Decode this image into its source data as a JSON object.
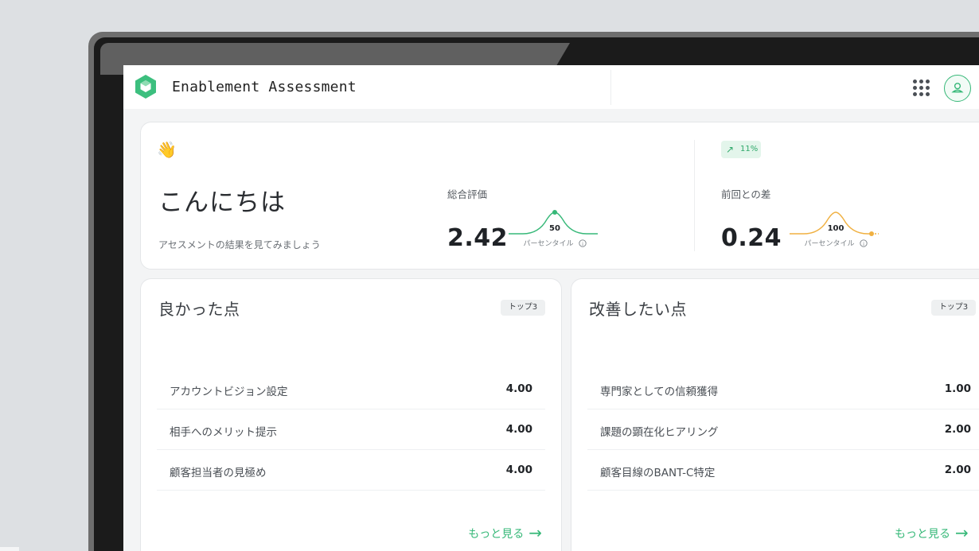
{
  "app": {
    "title": "Enablement Assessment"
  },
  "hero": {
    "greeting": "こんにちは",
    "subtitle": "アセスメントの結果を見てみましょう",
    "wave_emoji": "👋",
    "overall": {
      "label": "総合評価",
      "value": "2.42",
      "percentile": "50",
      "percentile_label": "パーセンタイル"
    },
    "diff": {
      "label": "前回との差",
      "value": "0.24",
      "percentile": "100",
      "percentile_label": "パーセンタイル",
      "trend": "11%"
    }
  },
  "good": {
    "title": "良かった点",
    "badge": "トップ3",
    "items": [
      {
        "label": "アカウントビジョン設定",
        "value": "4.00"
      },
      {
        "label": "相手へのメリット提示",
        "value": "4.00"
      },
      {
        "label": "顧客担当者の見極め",
        "value": "4.00"
      }
    ],
    "more": "もっと見る"
  },
  "improve": {
    "title": "改善したい点",
    "badge": "トップ3",
    "items": [
      {
        "label": "専門家としての信頼獲得",
        "value": "1.00"
      },
      {
        "label": "課題の顕在化ヒアリング",
        "value": "2.00"
      },
      {
        "label": "顧客目線のBANT-C特定",
        "value": "2.00"
      }
    ],
    "more": "もっと見る"
  },
  "colors": {
    "accent": "#36b878",
    "orange": "#f0b040"
  },
  "icons": [
    "logo-icon",
    "apps-grid-icon",
    "user-icon",
    "trend-up-icon",
    "arrow-right-icon",
    "info-icon"
  ]
}
